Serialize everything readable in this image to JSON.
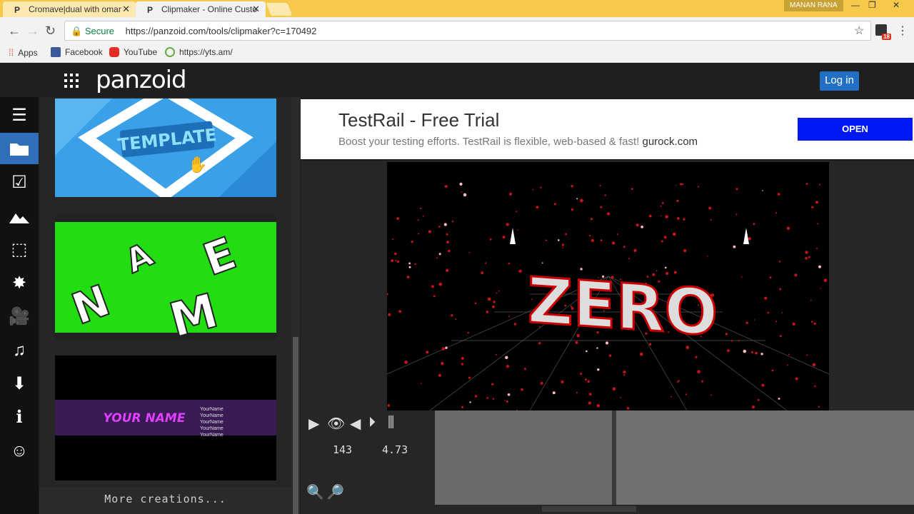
{
  "browser": {
    "tabs": [
      {
        "label": "Cromave|dual with omar"
      },
      {
        "label": "Clipmaker - Online Custo"
      }
    ],
    "user": "MANAN RANA",
    "secure_label": "Secure",
    "url": "https://panzoid.com/tools/clipmaker?c=170492",
    "ext_badge": "18",
    "bookmarks": [
      "Apps",
      "Facebook",
      "YouTube",
      "https://yts.am/"
    ]
  },
  "site": {
    "logo": "panzoid",
    "login": "Log in"
  },
  "sidebar": {
    "icons": [
      "menu-icon",
      "folder-icon",
      "checkbox-icon",
      "image-icon",
      "cube-icon",
      "burst-icon",
      "camera-icon",
      "music-icon",
      "download-icon",
      "info-icon",
      "smiley-icon"
    ]
  },
  "gallery": {
    "thumbs": [
      {
        "text": "TEMPLATE"
      },
      {
        "letters": [
          "N",
          "A",
          "E",
          "M"
        ]
      },
      {
        "title": "YOUR NAME",
        "lines": [
          "YourName",
          "YourName",
          "YourName",
          "YourName",
          "YourName"
        ]
      }
    ],
    "more": "More creations..."
  },
  "ad": {
    "title": "TestRail - Free Trial",
    "subtitle": "Boost your testing efforts. TestRail is flexible, web-based & fast!",
    "domain": "gurock.com",
    "button": "OPEN"
  },
  "preview": {
    "text": "ZERO"
  },
  "controls": {
    "frame": "143",
    "time": "4.73"
  },
  "colors": {
    "accent": "#2f6fb7",
    "ad_button": "#0018f5",
    "thumb_green": "#22dd11",
    "thumb_blue": "#3aa0e8"
  }
}
